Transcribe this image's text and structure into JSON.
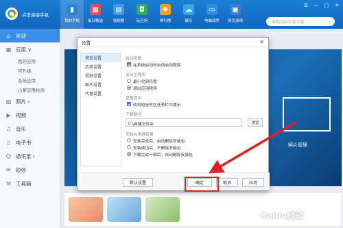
{
  "app": {
    "connection_status": "点击连接手机",
    "search_placeholder": "搜索应用/资源/功能",
    "window_controls": [
      "☰",
      "—",
      "□",
      "✕"
    ]
  },
  "topnav": [
    {
      "label": "我的手机",
      "icon": "phone-icon",
      "glyph": "▮",
      "color": "#2b86d9",
      "active": true
    },
    {
      "label": "每日精选",
      "icon": "calendar-icon",
      "glyph": "▦",
      "color": "#e94b5a",
      "active": false
    },
    {
      "label": "视频娱",
      "icon": "video-icon",
      "glyph": "▤",
      "color": "#3b9be6",
      "active": false
    },
    {
      "label": "玩应用",
      "icon": "lock-icon",
      "glyph": "◘",
      "color": "#2fae5c",
      "active": false
    },
    {
      "label": "排行榜",
      "icon": "rank-icon",
      "glyph": "✹",
      "color": "#f0a020",
      "active": false
    },
    {
      "label": "娱乐",
      "icon": "cloud-icon",
      "glyph": "☁",
      "color": "#38a5e8",
      "active": false
    },
    {
      "label": "电脑软件",
      "icon": "monitor-icon",
      "glyph": "▭",
      "color": "#2c8fe0",
      "active": false
    },
    {
      "label": "网页游戏",
      "icon": "web-icon",
      "glyph": "▣",
      "color": "#3d7fd0",
      "active": false
    }
  ],
  "sidebar": {
    "items": [
      {
        "label": "欢迎",
        "icon": "home-icon",
        "glyph": "⌂",
        "active": true
      },
      {
        "label": "应用 ∨",
        "icon": "apps-icon",
        "glyph": "▦",
        "active": false
      }
    ],
    "sub_items": [
      "我的应用",
      "可升级",
      "系统应用",
      "山寨应用检测"
    ],
    "items2": [
      {
        "label": "照片 ›",
        "icon": "photo-icon",
        "glyph": "▨"
      },
      {
        "label": "视频",
        "icon": "video-icon",
        "glyph": "▶"
      },
      {
        "label": "音乐",
        "icon": "music-icon",
        "glyph": "♫"
      },
      {
        "label": "电子书",
        "icon": "book-icon",
        "glyph": "▯"
      },
      {
        "label": "通讯录 ›",
        "icon": "contacts-icon",
        "glyph": "☺"
      },
      {
        "label": "短信",
        "icon": "sms-icon",
        "glyph": "✉"
      },
      {
        "label": "工具箱",
        "icon": "toolbox-icon",
        "glyph": "⚒"
      }
    ]
  },
  "banner": {
    "photo_label": "照片管理"
  },
  "dialog": {
    "title": "设置",
    "close": "✕",
    "nav": [
      "常规设置",
      "应用设置",
      "视频设置",
      "图片设置",
      "代理设置"
    ],
    "sections": {
      "startup": {
        "title": "启动设置",
        "options": [
          "在系统启动时自动启动程序"
        ]
      },
      "close_program": {
        "title": "关闭主程序",
        "options": [
          "最小化到托盘",
          "退出应用程序"
        ],
        "selected": 1
      },
      "notice": {
        "title": "提醒提示",
        "options": [
          "收到短信时在任务栏中提示"
        ]
      },
      "download": {
        "title": "下载路径",
        "path": "C:\\新建文件夹",
        "browse": "浏览"
      },
      "install": {
        "title": "安装包清理设置",
        "options": [
          "安装完成后，自动删除安装包",
          "安装成功后，不删除安装包",
          "下载完成一周后，自动删除安装包"
        ],
        "selected": 2
      }
    },
    "buttons": {
      "default": "默认设置",
      "ok": "确定",
      "cancel": "取消",
      "apply": "应用"
    }
  },
  "watermark": "Baidu经验"
}
